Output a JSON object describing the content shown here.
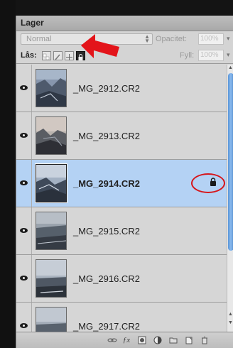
{
  "panel": {
    "tab_label": "Lager"
  },
  "blend": {
    "mode": "Normal",
    "opacity_label": "Opacitet:",
    "opacity_value": "100%"
  },
  "lock": {
    "label": "Lås:",
    "fill_label": "Fyll:",
    "fill_value": "100%"
  },
  "layers": [
    {
      "name": "_MG_2912.CR2",
      "selected": false,
      "locked": false
    },
    {
      "name": "_MG_2913.CR2",
      "selected": false,
      "locked": false
    },
    {
      "name": "_MG_2914.CR2",
      "selected": true,
      "locked": true
    },
    {
      "name": "_MG_2915.CR2",
      "selected": false,
      "locked": false
    },
    {
      "name": "_MG_2916.CR2",
      "selected": false,
      "locked": false
    },
    {
      "name": "_MG_2917.CR2",
      "selected": false,
      "locked": false
    }
  ],
  "bottom_bar": {
    "icons": [
      "link-icon",
      "fx-icon",
      "mask-icon",
      "adjustment-icon",
      "group-folder-icon",
      "new-layer-icon",
      "trash-icon"
    ]
  },
  "colors": {
    "annotation_red": "#d6161b",
    "selection_blue": "#b4d2f4",
    "scroll_blue": "#5a95d8"
  }
}
